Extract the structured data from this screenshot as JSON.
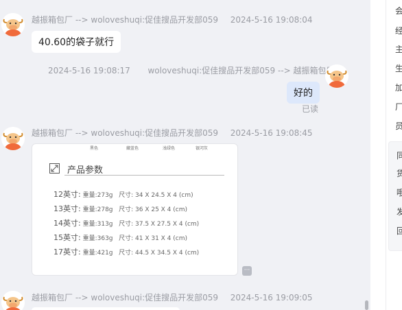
{
  "colors": {
    "chat_bg": "#f0f1f5",
    "mine_bubble": "#dde8fb",
    "avatar_orange": "#f06a3b"
  },
  "messages": [
    {
      "sender": "越振箱包厂",
      "arrow": "-->",
      "receiver": "woloveshuqi:促佳搜品开发部059",
      "time": "2024-5-16 19:08:04",
      "text": "40.60的袋子就行"
    },
    {
      "time": "2024-5-16 19:08:17",
      "sender": "woloveshuqi:促佳搜品开发部059",
      "arrow": "-->",
      "receiver": "越振箱包厂",
      "text": "好的",
      "status": "已读"
    },
    {
      "sender": "越振箱包厂",
      "arrow": "-->",
      "receiver": "woloveshuqi:促佳搜品开发部059",
      "time": "2024-5-16 19:08:45",
      "image": {
        "colors": [
          "黑色",
          "藏蓝色",
          "浅绿色",
          "银河灰"
        ],
        "title": "产品参数",
        "specs": [
          {
            "size": "12英寸:",
            "weight": "重量:273g",
            "dims": "尺寸:  34 X 24.5 X 4 (cm)"
          },
          {
            "size": "13英寸:",
            "weight": "重量:278g",
            "dims": "尺寸:  36 X 25 X 4 (cm)"
          },
          {
            "size": "14英寸:",
            "weight": "重量:313g",
            "dims": "尺寸:  37.5 X 27.5 X 4 (cm)"
          },
          {
            "size": "15英寸:",
            "weight": "重量:363g",
            "dims": "尺寸:  41 X 31 X 4 (cm)"
          },
          {
            "size": "17英寸:",
            "weight": "重量:421g",
            "dims": "尺寸:  44.5 X 34.5 X 4 (cm)"
          }
        ]
      }
    },
    {
      "sender": "越振箱包厂",
      "arrow": "-->",
      "receiver": "woloveshuqi:促佳搜品开发部059",
      "time": "2024-5-16 19:09:05"
    }
  ],
  "sidebar": {
    "items": [
      "会",
      "经",
      "主",
      "生",
      "加",
      "厂",
      "员"
    ],
    "card_items": [
      "同",
      "货",
      "哦",
      "发",
      "回"
    ]
  }
}
